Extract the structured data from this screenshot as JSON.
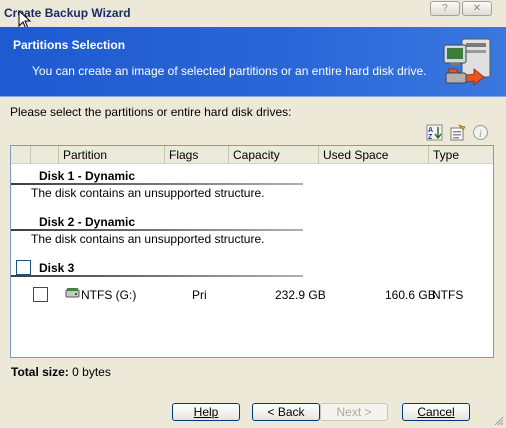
{
  "window": {
    "title": "Create Backup Wizard"
  },
  "titlebar_buttons": {
    "help": "?",
    "close": "✕"
  },
  "header": {
    "title": "Partitions Selection",
    "subtitle": "You can create an image of selected partitions or an entire hard disk drive."
  },
  "prompt": "Please select the partitions or entire hard disk drives:",
  "columns": [
    "Partition",
    "Flags",
    "Capacity",
    "Used Space",
    "Type"
  ],
  "disks": [
    {
      "title": "Disk 1 - Dynamic",
      "message": "The disk contains an unsupported structure."
    },
    {
      "title": "Disk 2 - Dynamic",
      "message": "The disk contains an unsupported structure."
    },
    {
      "title": "Disk 3"
    }
  ],
  "partition": {
    "name": "NTFS (G:)",
    "flags": "Pri",
    "capacity": "232.9 GB",
    "used": "160.6 GB",
    "type": "NTFS"
  },
  "footer": {
    "label": "Total size:",
    "value": "0 bytes"
  },
  "buttons": {
    "help": "Help",
    "back": "< Back",
    "next": "Next >",
    "cancel": "Cancel"
  },
  "colors": {
    "header_blue": "#1e5ad0",
    "window_bg": "#ece9d8",
    "button_border": "#003c74"
  },
  "icons": [
    "mouse-cursor-icon",
    "backup-wizard-icon",
    "sort-icon",
    "properties-icon",
    "info-icon",
    "partition-icon",
    "resize-grip-icon"
  ]
}
